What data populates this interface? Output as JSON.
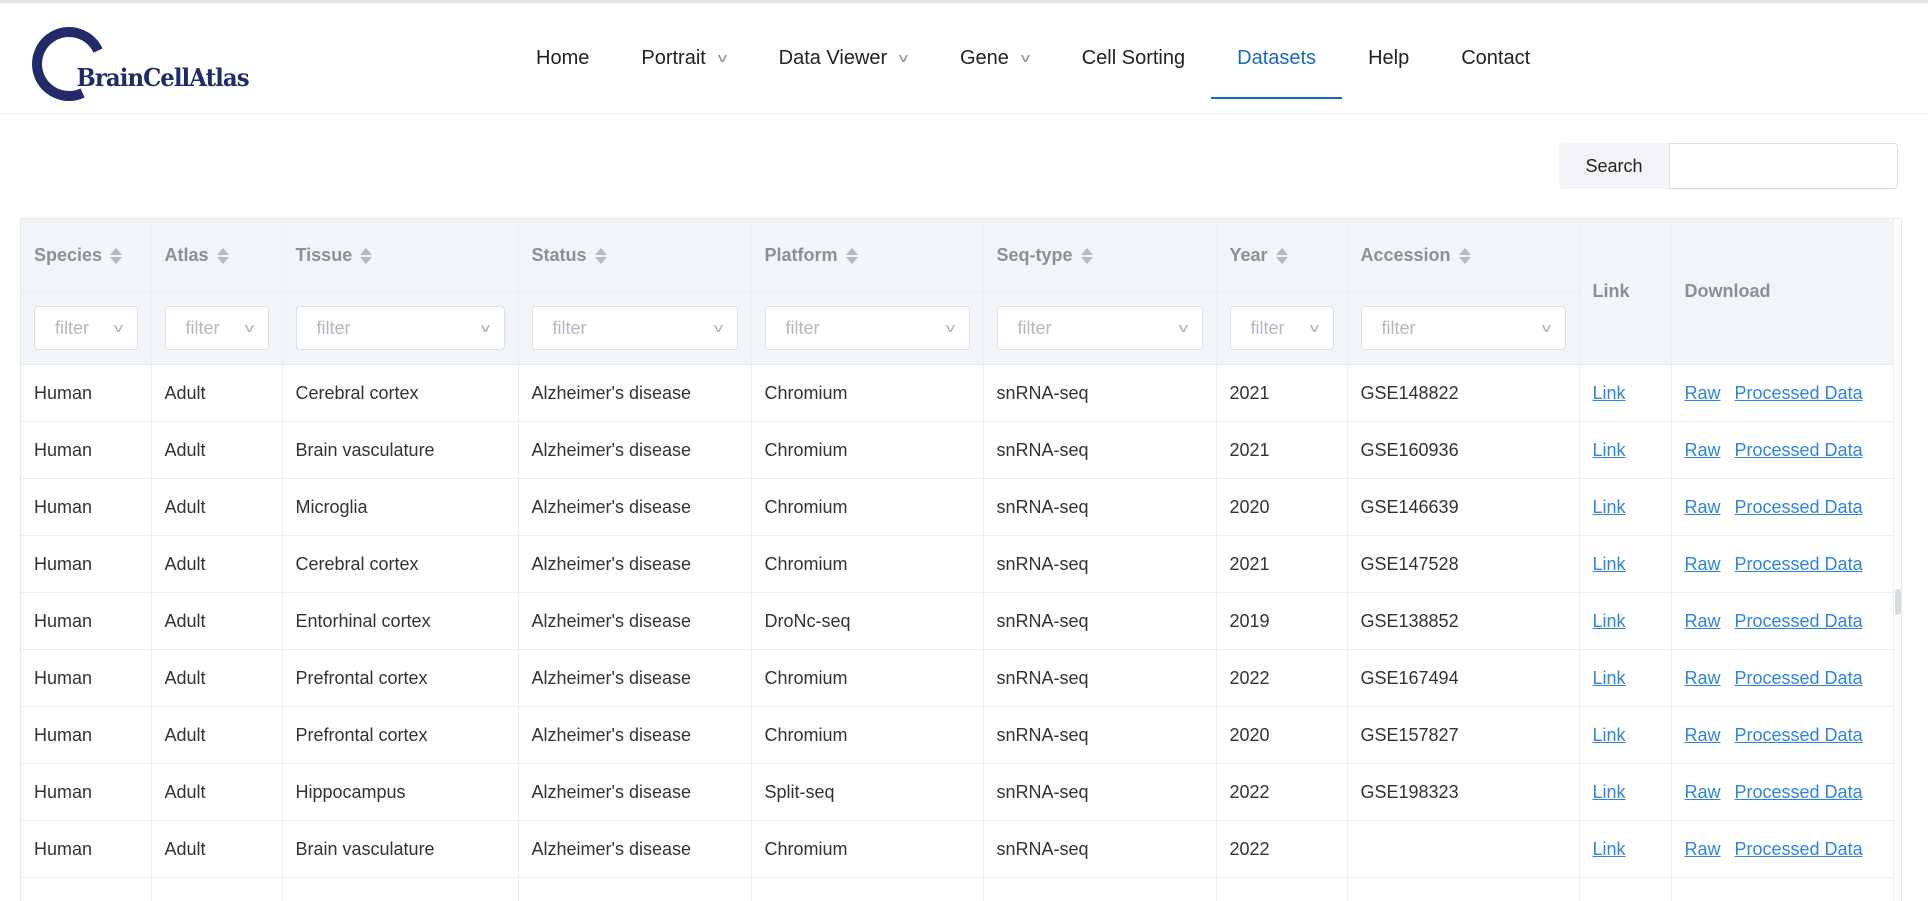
{
  "logo": {
    "text": "BrainCellAtlas"
  },
  "nav": [
    {
      "label": "Home",
      "dropdown": false,
      "active": false
    },
    {
      "label": "Portrait",
      "dropdown": true,
      "active": false
    },
    {
      "label": "Data Viewer",
      "dropdown": true,
      "active": false
    },
    {
      "label": "Gene",
      "dropdown": true,
      "active": false
    },
    {
      "label": "Cell Sorting",
      "dropdown": false,
      "active": false
    },
    {
      "label": "Datasets",
      "dropdown": false,
      "active": true
    },
    {
      "label": "Help",
      "dropdown": false,
      "active": false
    },
    {
      "label": "Contact",
      "dropdown": false,
      "active": false
    }
  ],
  "search": {
    "label": "Search",
    "value": ""
  },
  "columns": [
    "Species",
    "Atlas",
    "Tissue",
    "Status",
    "Platform",
    "Seq-type",
    "Year",
    "Accession"
  ],
  "link_header": "Link",
  "download_header": "Download",
  "filter_placeholder": "filter",
  "link_label": "Link",
  "raw_label": "Raw",
  "processed_label": "Processed Data",
  "rows": [
    [
      "Human",
      "Adult",
      "Cerebral cortex",
      "Alzheimer's disease",
      "Chromium",
      "snRNA-seq",
      "2021",
      "GSE148822"
    ],
    [
      "Human",
      "Adult",
      "Brain vasculature",
      "Alzheimer's disease",
      "Chromium",
      "snRNA-seq",
      "2021",
      "GSE160936"
    ],
    [
      "Human",
      "Adult",
      "Microglia",
      "Alzheimer's disease",
      "Chromium",
      "snRNA-seq",
      "2020",
      "GSE146639"
    ],
    [
      "Human",
      "Adult",
      "Cerebral cortex",
      "Alzheimer's disease",
      "Chromium",
      "snRNA-seq",
      "2021",
      "GSE147528"
    ],
    [
      "Human",
      "Adult",
      "Entorhinal cortex",
      "Alzheimer's disease",
      "DroNc-seq",
      "snRNA-seq",
      "2019",
      "GSE138852"
    ],
    [
      "Human",
      "Adult",
      "Prefrontal cortex",
      "Alzheimer's disease",
      "Chromium",
      "snRNA-seq",
      "2022",
      "GSE167494"
    ],
    [
      "Human",
      "Adult",
      "Prefrontal cortex",
      "Alzheimer's disease",
      "Chromium",
      "snRNA-seq",
      "2020",
      "GSE157827"
    ],
    [
      "Human",
      "Adult",
      "Hippocampus",
      "Alzheimer's disease",
      "Split-seq",
      "snRNA-seq",
      "2022",
      "GSE198323"
    ],
    [
      "Human",
      "Adult",
      "Brain vasculature",
      "Alzheimer's disease",
      "Chromium",
      "snRNA-seq",
      "2022",
      ""
    ]
  ],
  "colors": {
    "accent": "#1c67c6",
    "link": "#2f84de",
    "logo": "#232a6b",
    "header_bg": "#f2f5f8"
  }
}
